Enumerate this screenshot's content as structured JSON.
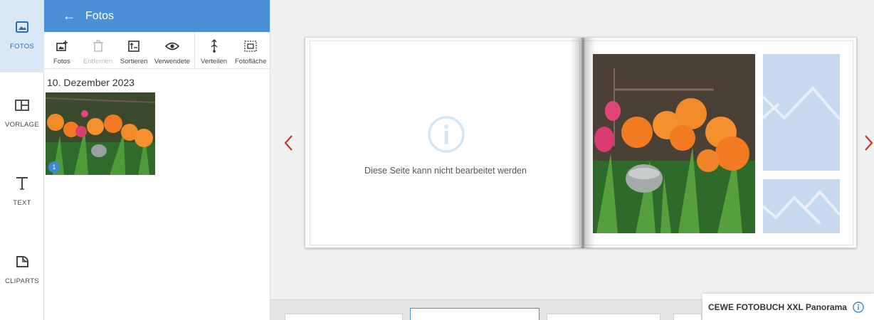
{
  "rail": {
    "items": [
      {
        "label": "FOTOS",
        "icon": "image-icon",
        "active": true
      },
      {
        "label": "VORLAGE",
        "icon": "layout-icon",
        "active": false
      },
      {
        "label": "TEXT",
        "icon": "text-icon",
        "active": false
      },
      {
        "label": "CLIPARTS",
        "icon": "clipart-icon",
        "active": false
      }
    ]
  },
  "panel": {
    "title": "Fotos",
    "toolbar": [
      {
        "label": "Fotos",
        "icon": "add-photo-icon"
      },
      {
        "label": "Entfernen",
        "icon": "trash-icon",
        "disabled": true
      },
      {
        "label": "Sortieren",
        "icon": "sort-icon"
      },
      {
        "label": "Verwendete",
        "icon": "eye-icon"
      },
      {
        "label": "Verteilen",
        "icon": "distribute-icon"
      },
      {
        "label": "Fotofläche",
        "icon": "photo-area-icon"
      }
    ],
    "date_group": "10. Dezember 2023",
    "photo_usage_count": "1"
  },
  "book": {
    "left_page_message": "Diese Seite kann nicht bearbeitet werden"
  },
  "product": {
    "name": "CEWE FOTOBUCH XXL Panorama"
  },
  "colors": {
    "accent": "#4a90d6",
    "rail_active": "#d9e8f6",
    "nav_arrow": "#c0392b",
    "placeholder": "#c7d9ee"
  }
}
